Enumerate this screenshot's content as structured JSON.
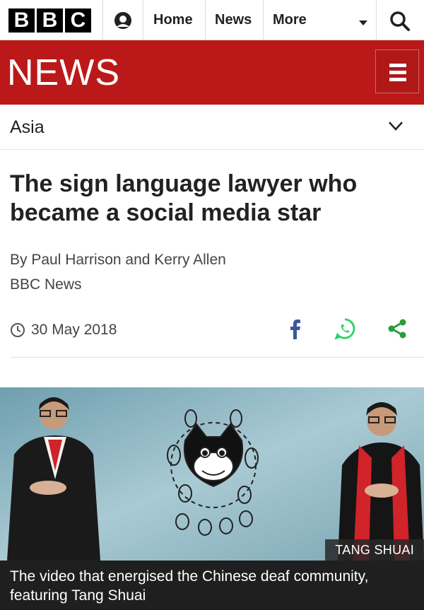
{
  "brand": {
    "letters": [
      "B",
      "B",
      "C"
    ]
  },
  "nav": {
    "home_label": "Home",
    "news_label": "News",
    "more_label": "More"
  },
  "masthead": {
    "title": "NEWS",
    "color": "#bb1919"
  },
  "section": {
    "label": "Asia"
  },
  "article": {
    "headline": "The sign language lawyer who became a social media star",
    "byline": "By Paul Harrison and Kerry Allen",
    "organization": "BBC News",
    "date": "30 May 2018"
  },
  "share": {
    "icons": [
      "facebook-icon",
      "whatsapp-icon",
      "share-icon"
    ],
    "colors": {
      "facebook": "#3b5998",
      "whatsapp": "#25d366",
      "share": "#2a9c3a"
    }
  },
  "media": {
    "credit": "TANG SHUAI",
    "caption": "The video that energised the Chinese deaf community, featuring Tang Shuai"
  }
}
